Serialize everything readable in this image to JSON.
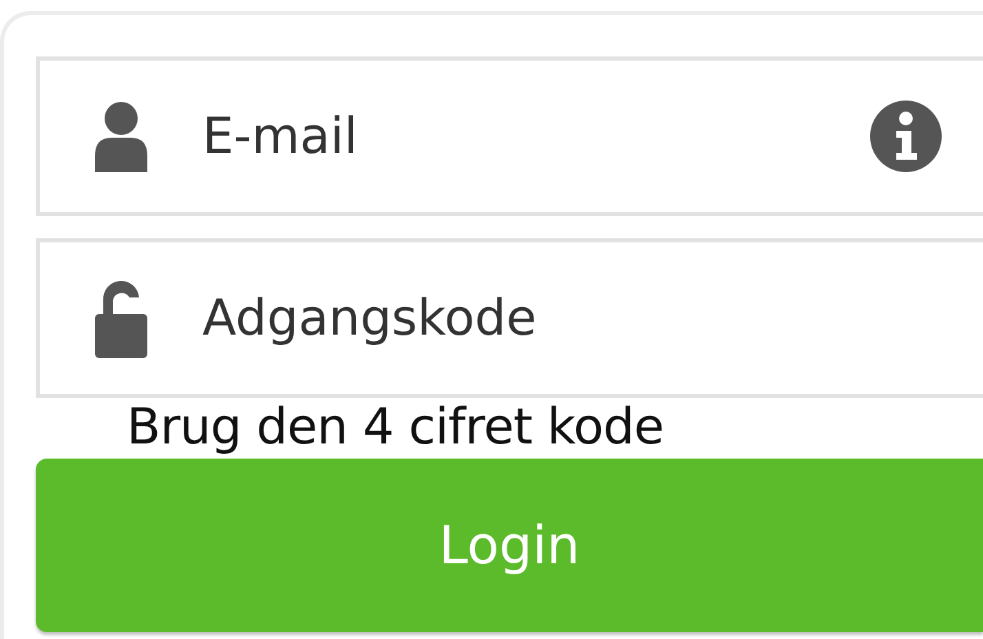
{
  "fields": [
    {
      "kind": "email",
      "placeholder": "E-mail",
      "info": true
    },
    {
      "kind": "password",
      "placeholder": "Adgangskode",
      "info": false
    }
  ],
  "hint": "Brug den 4 cifret kode",
  "login_button": "Login"
}
